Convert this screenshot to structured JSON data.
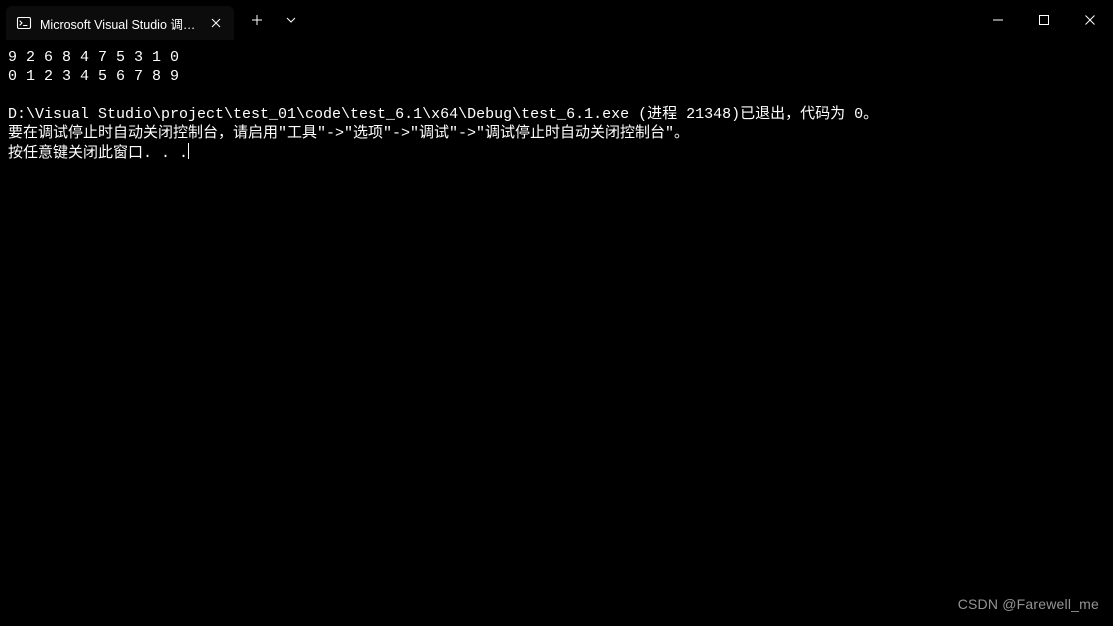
{
  "window": {
    "tab_title": "Microsoft Visual Studio 调试控制台"
  },
  "console": {
    "line1": "9 2 6 8 4 7 5 3 1 0",
    "line2": "0 1 2 3 4 5 6 7 8 9",
    "blank": "",
    "exit_line": "D:\\Visual Studio\\project\\test_01\\code\\test_6.1\\x64\\Debug\\test_6.1.exe (进程 21348)已退出，代码为 0。",
    "hint_line": "要在调试停止时自动关闭控制台，请启用\"工具\"->\"选项\"->\"调试\"->\"调试停止时自动关闭控制台\"。",
    "press_any_key": "按任意键关闭此窗口. . ."
  },
  "watermark": {
    "text": "CSDN @Farewell_me"
  }
}
